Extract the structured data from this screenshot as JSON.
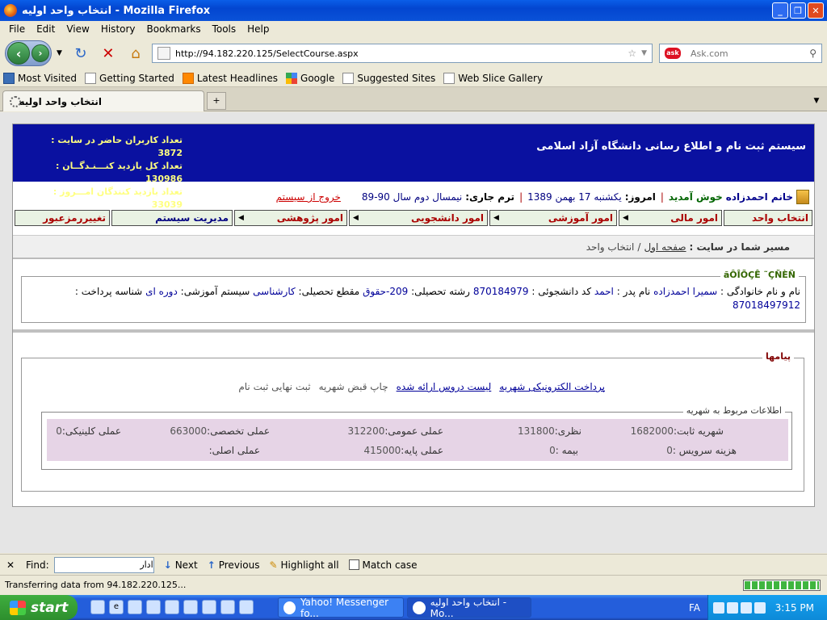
{
  "window": {
    "title": "انتخاب واحد اولیه - Mozilla Firefox"
  },
  "menubar": [
    "File",
    "Edit",
    "View",
    "History",
    "Bookmarks",
    "Tools",
    "Help"
  ],
  "nav": {
    "url": "http://94.182.220.125/SelectCourse.aspx",
    "search_placeholder": "Ask.com"
  },
  "bookmarks": [
    "Most Visited",
    "Getting Started",
    "Latest Headlines",
    "Google",
    "Suggested Sites",
    "Web Slice Gallery"
  ],
  "tab": {
    "label": "انتخاب واحد اولیه",
    "new_tab": "+"
  },
  "banner": {
    "system_title": "سیستم ثبت نام و اطلاع رسانی دانشگاه آزاد اسلامی",
    "stats": [
      "تعداد کاربران حاضر در سایت : 3872",
      "تعداد کل بازدید کنـــنـدگــان : 130986",
      "تعداد بازدید کنندگان امـــروز : 33039"
    ]
  },
  "userline": {
    "name": "خانم احمدزاده",
    "welcome": "خوش آمدید",
    "today_label": "امروز:",
    "today_value": "یکشنبه 17 بهمن 1389",
    "term_label": "ترم جاری:",
    "term_value": "نیمسال دوم سال 90-89",
    "logout": "خروج از سیستم",
    "separator": "|"
  },
  "menu": [
    "انتخاب واحد",
    "امور مالی",
    "امور آموزشی",
    "امور دانشجویی",
    "امور پژوهشی",
    "مدیریت سیستم",
    "تغییررمزعبور"
  ],
  "path": {
    "label": "مسیر شما در سایت :",
    "home": "صفحه اول",
    "sep": "/",
    "current": "انتخاب واحد"
  },
  "profile": {
    "legend": "ãÔÎÕÇÊ ˜ÇÑÈÑ",
    "name_label": "نام و نام خانوادگی :",
    "name_value": "سمیرا احمدزاده",
    "father_label": "نام پدر :",
    "father_value": "احمد",
    "id_label": "کد دانشجوئی :",
    "id_value": "870184979",
    "field_label": "رشته تحصیلی:",
    "field_value": "209-حقوق",
    "level_label": "مقطع تحصیلی:",
    "level_value": "کارشناسی",
    "system_label": "سیستم آموزشی:",
    "system_value": "دوره ای",
    "payid_label": "شناسه پرداخت :",
    "payid_value": "87018497912"
  },
  "messages": {
    "legend": "پیامها",
    "links": [
      "پرداخت الکترونیکی شهریه",
      "لیست دروس ارائه شده"
    ],
    "texts": [
      "چاپ قبض شهریه",
      "ثبت نهایی ثبت نام"
    ]
  },
  "fees": {
    "legend": "اطلاعات مربوط به شهریه",
    "row1": [
      {
        "label": "شهریه ثابت:",
        "value": "1682000"
      },
      {
        "label": "نظری:",
        "value": "131800"
      },
      {
        "label": "عملی عمومی:",
        "value": "312200"
      },
      {
        "label": "عملی تخصصی:",
        "value": "663000"
      },
      {
        "label": "عملی کلینیکی:",
        "value": "0"
      }
    ],
    "row2": [
      {
        "label": "هزینه سرویس :",
        "value": "0"
      },
      {
        "label": "بیمه :",
        "value": "0"
      },
      {
        "label": "عملی پایه:",
        "value": "415000"
      },
      {
        "label": "عملی اصلی:",
        "value": ""
      }
    ]
  },
  "findbar": {
    "label": "Find:",
    "value": "ادار",
    "next": "Next",
    "previous": "Previous",
    "highlight": "Highlight all",
    "match": "Match case"
  },
  "status": {
    "text": "Transferring data from 94.182.220.125...",
    "progress": 1.0
  },
  "taskbar": {
    "start": "start",
    "items": [
      "Yahoo! Messenger fo...",
      "انتخاب واحد اولیه - Mo..."
    ],
    "lang": "FA",
    "clock": "3:15 PM"
  }
}
